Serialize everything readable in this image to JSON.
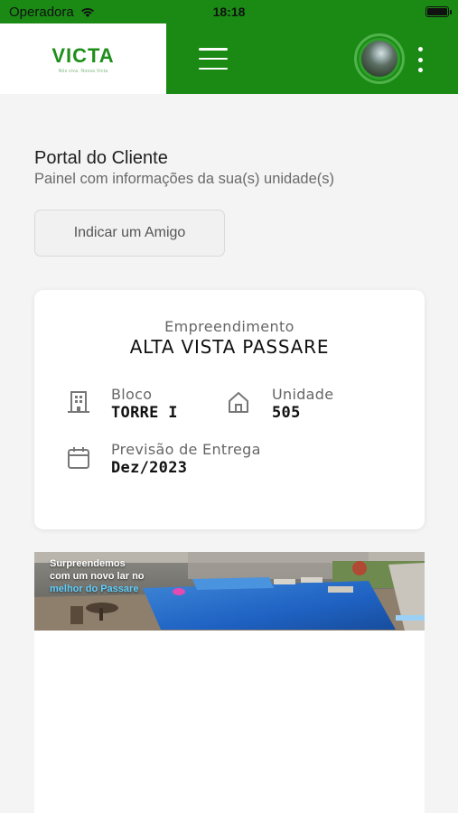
{
  "status_bar": {
    "carrier": "Operadora",
    "time": "18:18"
  },
  "header": {
    "logo_text": "VICTA",
    "logo_tagline": "Nós viva. Nossa Victa",
    "menu_icon": "hamburger-icon",
    "more_icon": "kebab-icon"
  },
  "page": {
    "title": "Portal do Cliente",
    "subtitle": "Painel com informações da sua(s) unidade(s)",
    "refer_button_label": "Indicar um Amigo"
  },
  "card": {
    "project_label": "Empreendimento",
    "project_name": "ALTA VISTA PASSARE",
    "block": {
      "label": "Bloco",
      "value": "TORRE I",
      "icon": "building-icon"
    },
    "unit": {
      "label": "Unidade",
      "value": "505",
      "icon": "house-icon"
    },
    "delivery": {
      "label": "Previsão de Entrega",
      "value": "Dez/2023",
      "icon": "calendar-icon"
    }
  },
  "banner": {
    "line1": "Surpreendemos",
    "line2": "com um novo lar no",
    "line3": "melhor do Passare"
  },
  "colors": {
    "brand_green": "#1a8a15",
    "logo_green": "#1e8f1a",
    "background": "#f4f4f4"
  }
}
